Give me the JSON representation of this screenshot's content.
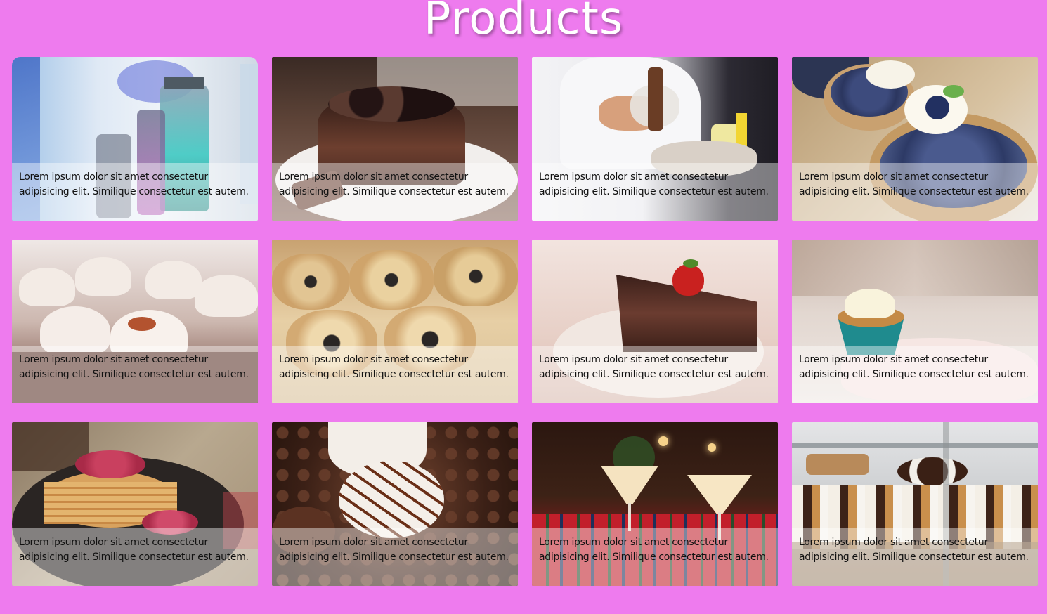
{
  "page": {
    "title": "Products"
  },
  "products": [
    {
      "caption": "Lorem ipsum dolor sit amet consectetur adipisicing elit. Similique consectetur est autem.",
      "image": "glass-jars-photo"
    },
    {
      "caption": "Lorem ipsum dolor sit amet consectetur adipisicing elit. Similique consectetur est autem.",
      "image": "chocolate-berry-cake-photo"
    },
    {
      "caption": "Lorem ipsum dolor sit amet consectetur adipisicing elit. Similique consectetur est autem.",
      "image": "chef-decorating-dessert-photo"
    },
    {
      "caption": "Lorem ipsum dolor sit amet consectetur adipisicing elit. Similique consectetur est autem.",
      "image": "blueberry-tarts-photo"
    },
    {
      "caption": "Lorem ipsum dolor sit amet consectetur adipisicing elit. Similique consectetur est autem.",
      "image": "frosted-cupcakes-photo"
    },
    {
      "caption": "Lorem ipsum dolor sit amet consectetur adipisicing elit. Similique consectetur est autem.",
      "image": "poppy-seed-rolls-photo"
    },
    {
      "caption": "Lorem ipsum dolor sit amet consectetur adipisicing elit. Similique consectetur est autem.",
      "image": "chocolate-cake-slice-photo"
    },
    {
      "caption": "Lorem ipsum dolor sit amet consectetur adipisicing elit. Similique consectetur est autem.",
      "image": "cupcake-in-hand-photo"
    },
    {
      "caption": "Lorem ipsum dolor sit amet consectetur adipisicing elit. Similique consectetur est autem.",
      "image": "raspberry-pancakes-photo"
    },
    {
      "caption": "Lorem ipsum dolor sit amet consectetur adipisicing elit. Similique consectetur est autem.",
      "image": "chocolate-drizzle-dessert-photo"
    },
    {
      "caption": "Lorem ipsum dolor sit amet consectetur adipisicing elit. Similique consectetur est autem.",
      "image": "holiday-dessert-glasses-photo"
    },
    {
      "caption": "Lorem ipsum dolor sit amet consectetur adipisicing elit. Similique consectetur est autem.",
      "image": "pastry-display-case-photo"
    }
  ],
  "colors": {
    "background": "#ee7bee",
    "title": "#ffffff",
    "caption_overlay": "rgba(255,255,255,0.42)"
  }
}
